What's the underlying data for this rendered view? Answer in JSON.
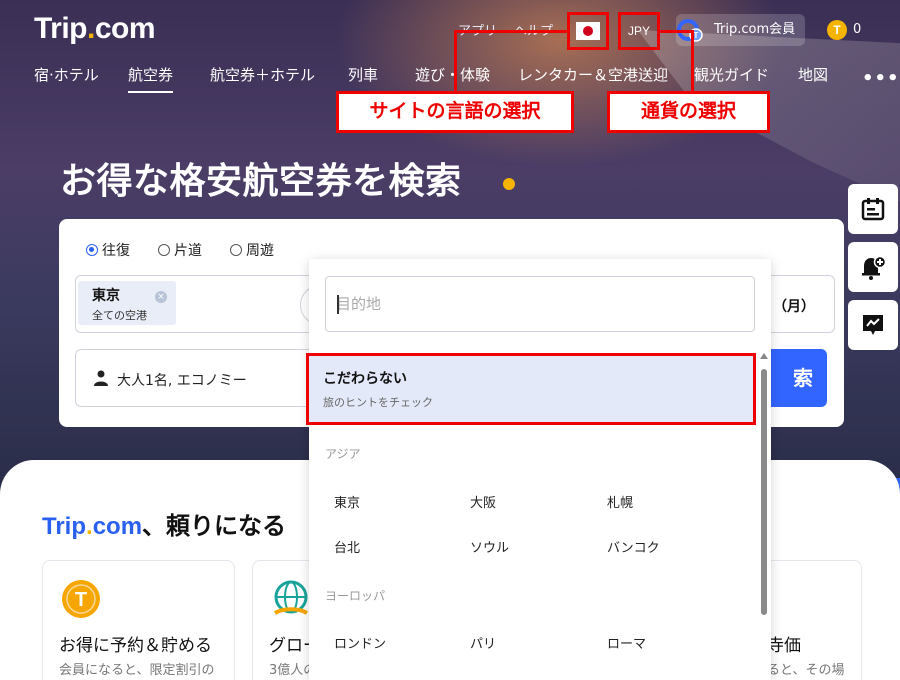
{
  "header": {
    "logo_main": "Trip",
    "logo_dot": ".",
    "logo_tail": "com",
    "app": "アプリ",
    "help": "ヘルプ",
    "currency": "JPY",
    "member": "Trip.com会員",
    "points": "0",
    "coin_letter": "T"
  },
  "nav": {
    "items": [
      "宿·ホテル",
      "航空券",
      "航空券＋ホテル",
      "列車",
      "遊び・体験",
      "レンタカー＆空港送迎",
      "観光ガイド",
      "地図"
    ],
    "more": "•••"
  },
  "callouts": {
    "language": "サイトの言語の選択",
    "currency": "通貨の選択"
  },
  "hero": {
    "headline": "お得な格安航空券を検索"
  },
  "search": {
    "trip_types": [
      "往復",
      "片道",
      "周遊"
    ],
    "from_city": "東京",
    "from_sub": "全ての空港",
    "date_fragment": "日（月）",
    "passengers": "大人1名, エコノミー",
    "search_fragment": "索"
  },
  "dropdown": {
    "placeholder": "目的地",
    "any": {
      "title": "こだわらない",
      "subtitle": "旅のヒントをチェック"
    },
    "regions": [
      {
        "name": "アジア",
        "cities": [
          "東京",
          "大阪",
          "札幌",
          "台北",
          "ソウル",
          "バンコク"
        ]
      },
      {
        "name": "ヨーロッパ",
        "cities": [
          "ロンドン",
          "パリ",
          "ローマ"
        ]
      }
    ]
  },
  "lower": {
    "brand_main": "Trip",
    "brand_dot": ".",
    "brand_tail": "com",
    "title_tail": "、頼りになる",
    "cards": [
      {
        "title": "お得に予約＆貯める",
        "subtitle": "会員になると、限定割引の"
      },
      {
        "title": "グロー",
        "subtitle": "3億人の"
      },
      {
        "title": "寺価",
        "subtitle": "ると、その場"
      }
    ]
  },
  "colors": {
    "accent_blue": "#3264ff",
    "callout_red": "#ee0000",
    "logo_yellow": "#f5b400"
  }
}
